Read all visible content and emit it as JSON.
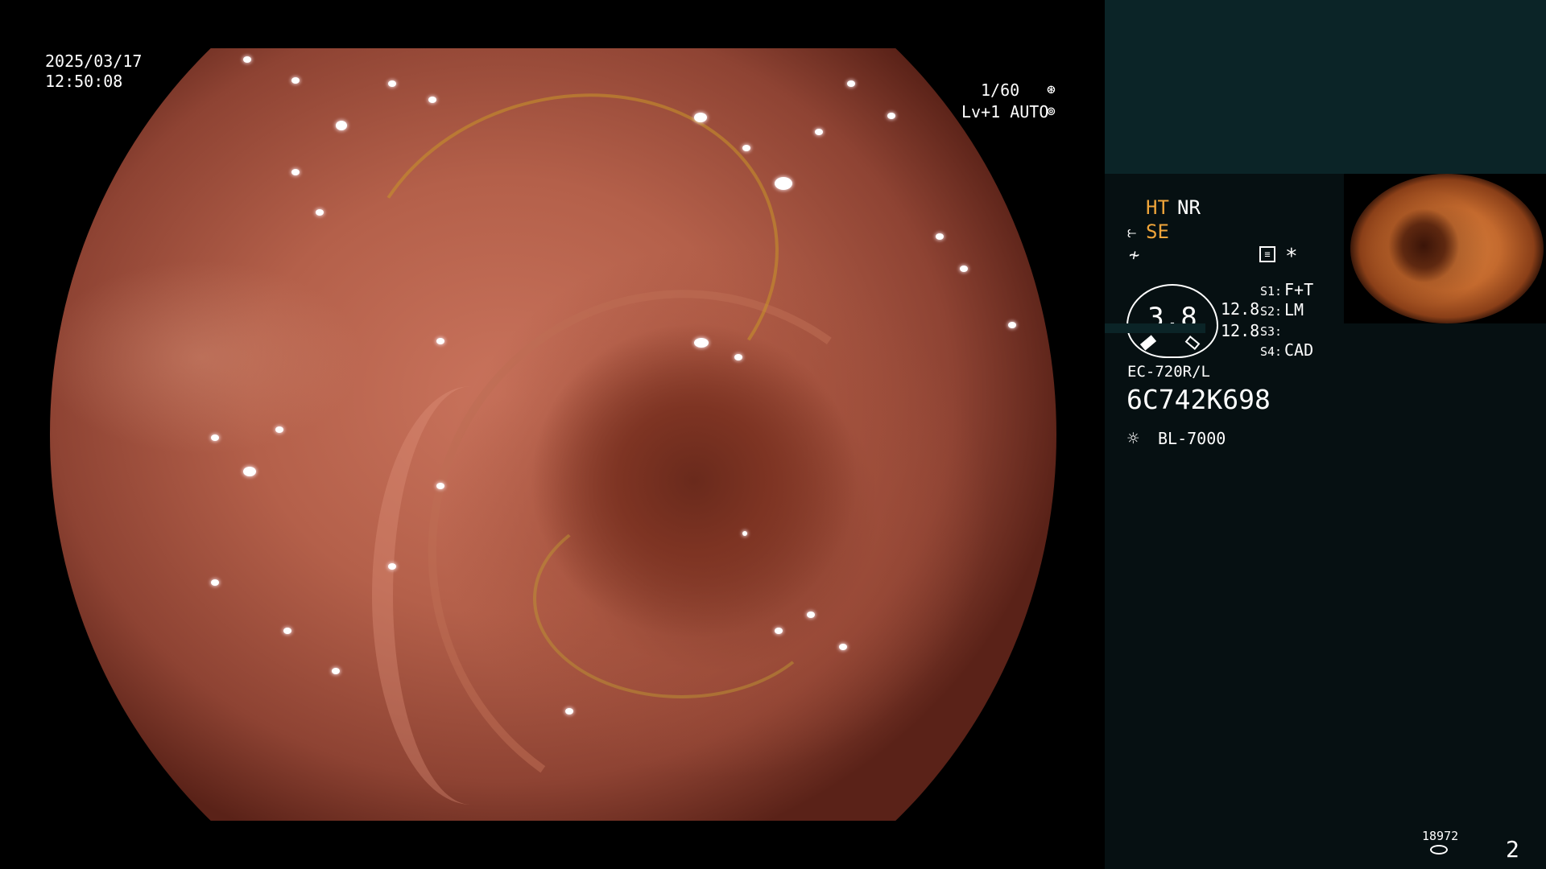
{
  "overlay": {
    "date": "2025/03/17",
    "time": "12:50:08",
    "shutter": "1/60",
    "level_mode": "Lv+1 AUTO"
  },
  "panel": {
    "row1_ht": "HT",
    "row1_nr": "NR",
    "row2_se": "SE",
    "gauge_value": "3.8",
    "side_val_1": "12.8",
    "side_val_2": "12.8",
    "settings": [
      {
        "key": "S1:",
        "value": "F+T"
      },
      {
        "key": "S2:",
        "value": "LM"
      },
      {
        "key": "S3:",
        "value": ""
      },
      {
        "key": "S4:",
        "value": "CAD"
      }
    ],
    "scope_model": "EC-720R/L",
    "scope_serial": "6C742K698",
    "light_source": "BL-7000",
    "storage_count": "18972",
    "page_number": "2",
    "asterisk": "*"
  },
  "icons": {
    "shutter": "shutter-aperture-icon",
    "auto": "auto-iris-icon",
    "bend": "scope-bend-icon",
    "freeze": "freeze-icon",
    "memo": "memo-list-icon",
    "light": "light-bulb-icon",
    "storage": "storage-disk-icon"
  },
  "colors": {
    "accent_orange": "#f0a53a",
    "panel_bg": "#061012",
    "panel_top": "#0b2427"
  }
}
